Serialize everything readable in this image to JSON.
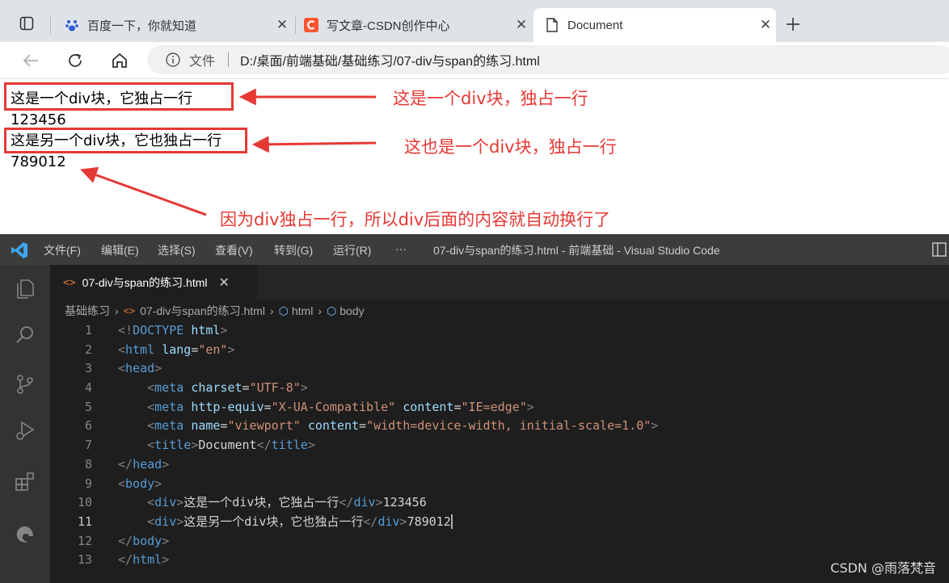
{
  "browser": {
    "tabs": [
      {
        "label": "百度一下，你就知道",
        "icon": "paw-icon"
      },
      {
        "label": "写文章-CSDN创作中心",
        "icon": "csdn-logo-icon"
      },
      {
        "label": "Document",
        "icon": "document-icon",
        "active": true
      }
    ],
    "address": {
      "scheme_label": "文件",
      "url": "D:/桌面/前端基础/基础练习/07-div与span的练习.html"
    }
  },
  "page": {
    "lines": [
      "这是一个div块，它独占一行",
      "123456",
      "这是另一个div块，它也独占一行",
      "789012"
    ],
    "annotations": [
      "这是一个div块，独占一行",
      "这也是一个div块，独占一行",
      "因为div独占一行，所以div后面的内容就自动换行了"
    ],
    "annotation_color": "#e53935"
  },
  "vscode": {
    "menu": [
      "文件(F)",
      "编辑(E)",
      "选择(S)",
      "查看(V)",
      "转到(G)",
      "运行(R)",
      "···"
    ],
    "window_title": "07-div与span的练习.html - 前端基础 - Visual Studio Code",
    "tab_label": "07-div与span的练习.html",
    "breadcrumb": [
      "基础练习",
      "07-div与span的练习.html",
      "html",
      "body"
    ],
    "current_line": 11,
    "code_lines": [
      "<!DOCTYPE html>",
      "<html lang=\"en\">",
      "<head>",
      "    <meta charset=\"UTF-8\">",
      "    <meta http-equiv=\"X-UA-Compatible\" content=\"IE=edge\">",
      "    <meta name=\"viewport\" content=\"width=device-width, initial-scale=1.0\">",
      "    <title>Document</title>",
      "</head>",
      "<body>",
      "    <div>这是一个div块，它独占一行</div>123456",
      "    <div>这是另一个div块，它也独占一行</div>789012",
      "</body>",
      "</html>"
    ]
  },
  "watermark": "CSDN @雨落梵音"
}
